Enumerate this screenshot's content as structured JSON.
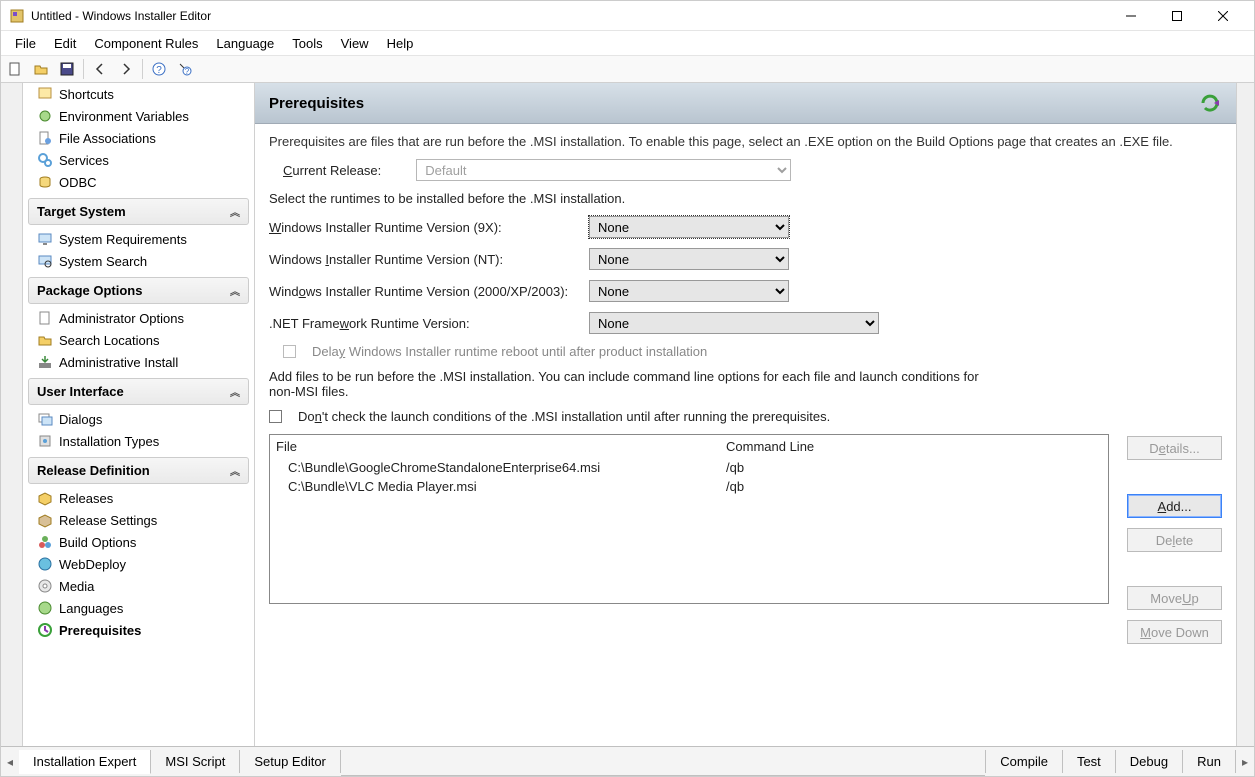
{
  "window": {
    "title": "Untitled - Windows Installer Editor"
  },
  "menu": {
    "file": "File",
    "edit": "Edit",
    "component_rules": "Component Rules",
    "language": "Language",
    "tools": "Tools",
    "view": "View",
    "help": "Help"
  },
  "sidebar": {
    "items_pre": {
      "shortcuts": "Shortcuts",
      "env_vars": "Environment Variables",
      "file_assoc": "File Associations",
      "services": "Services",
      "odbc": "ODBC"
    },
    "groups": {
      "target_system": "Target System",
      "package_options": "Package Options",
      "user_interface": "User Interface",
      "release_definition": "Release Definition"
    },
    "target_system": {
      "sys_req": "System Requirements",
      "sys_search": "System Search"
    },
    "package_options": {
      "admin_opts": "Administrator Options",
      "search_loc": "Search Locations",
      "admin_install": "Administrative Install"
    },
    "user_interface": {
      "dialogs": "Dialogs",
      "install_types": "Installation Types"
    },
    "release_definition": {
      "releases": "Releases",
      "release_settings": "Release Settings",
      "build_options": "Build Options",
      "webdeploy": "WebDeploy",
      "media": "Media",
      "languages": "Languages",
      "prerequisites": "Prerequisites"
    }
  },
  "page": {
    "title": "Prerequisites",
    "description": "Prerequisites are files that are run before the .MSI installation. To enable this page, select an .EXE option on the Build Options page that creates an .EXE file.",
    "current_release_label": "Current Release:",
    "current_release_value": "Default",
    "select_runtimes_text": "Select the runtimes to be installed before the .MSI installation.",
    "runtime_9x_label": "Windows Installer Runtime Version (9X):",
    "runtime_nt_label": "Windows Installer Runtime Version (NT):",
    "runtime_2000_label": "Windows Installer Runtime Version (2000/XP/2003):",
    "net_label": ".NET Framework Runtime Version:",
    "none_value": "None",
    "delay_reboot_label": "Delay Windows Installer runtime reboot until after product installation",
    "add_files_text": "Add files to be run before the .MSI installation. You can include command line options for each file and launch conditions for non-MSI files.",
    "dont_check_label": "Don't check the launch conditions of the .MSI installation until after running the prerequisites.",
    "table": {
      "col_file": "File",
      "col_cmd": "Command Line",
      "rows": [
        {
          "file": "C:\\Bundle\\GoogleChromeStandaloneEnterprise64.msi",
          "cmd": "/qb"
        },
        {
          "file": "C:\\Bundle\\VLC Media Player.msi",
          "cmd": "/qb"
        }
      ]
    },
    "buttons": {
      "details": "Details...",
      "add": "Add...",
      "delete": "Delete",
      "move_up": "Move Up",
      "move_down": "Move Down"
    }
  },
  "bottom": {
    "installation_expert": "Installation Expert",
    "msi_script": "MSI Script",
    "setup_editor": "Setup Editor",
    "compile": "Compile",
    "test": "Test",
    "debug": "Debug",
    "run": "Run"
  }
}
